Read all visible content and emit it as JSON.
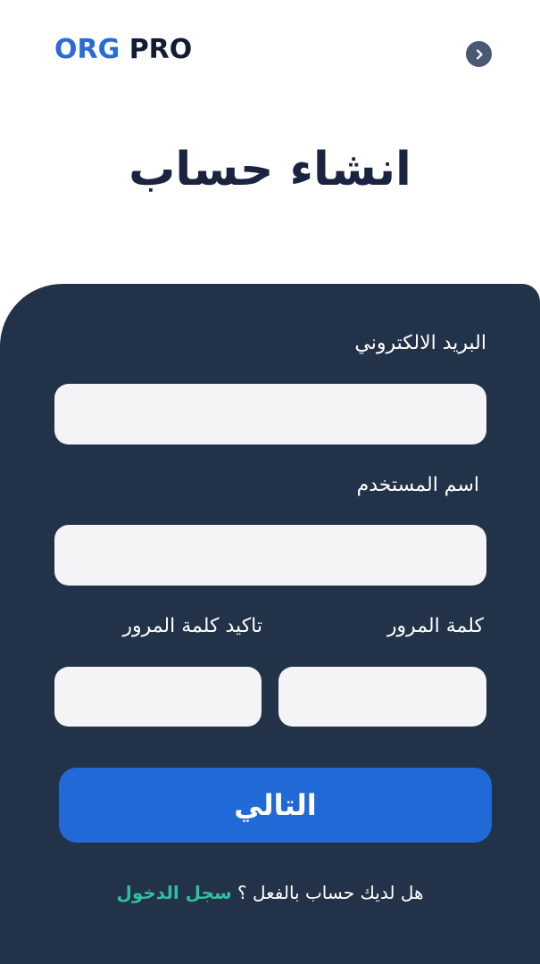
{
  "header": {
    "logo_org": "ORG",
    "logo_pro": "PRO",
    "back_icon": "chevron-right-icon"
  },
  "title": "انشاء حساب",
  "form": {
    "email_label": "البريد الالكتروني",
    "email_value": "",
    "username_label": "اسم المستخدم",
    "username_value": "",
    "password_label": "كلمة المرور",
    "password_value": "",
    "confirm_password_label": "تاكيد كلمة المرور",
    "confirm_password_value": "",
    "next_label": "التالي"
  },
  "login": {
    "question": "هل لديك حساب بالفعل ؟",
    "link": "سجل الدخول"
  },
  "colors": {
    "brand_blue": "#2a6bd6",
    "panel": "#223248",
    "button": "#2269d8",
    "link": "#2fbf9f",
    "title": "#1a2340"
  }
}
